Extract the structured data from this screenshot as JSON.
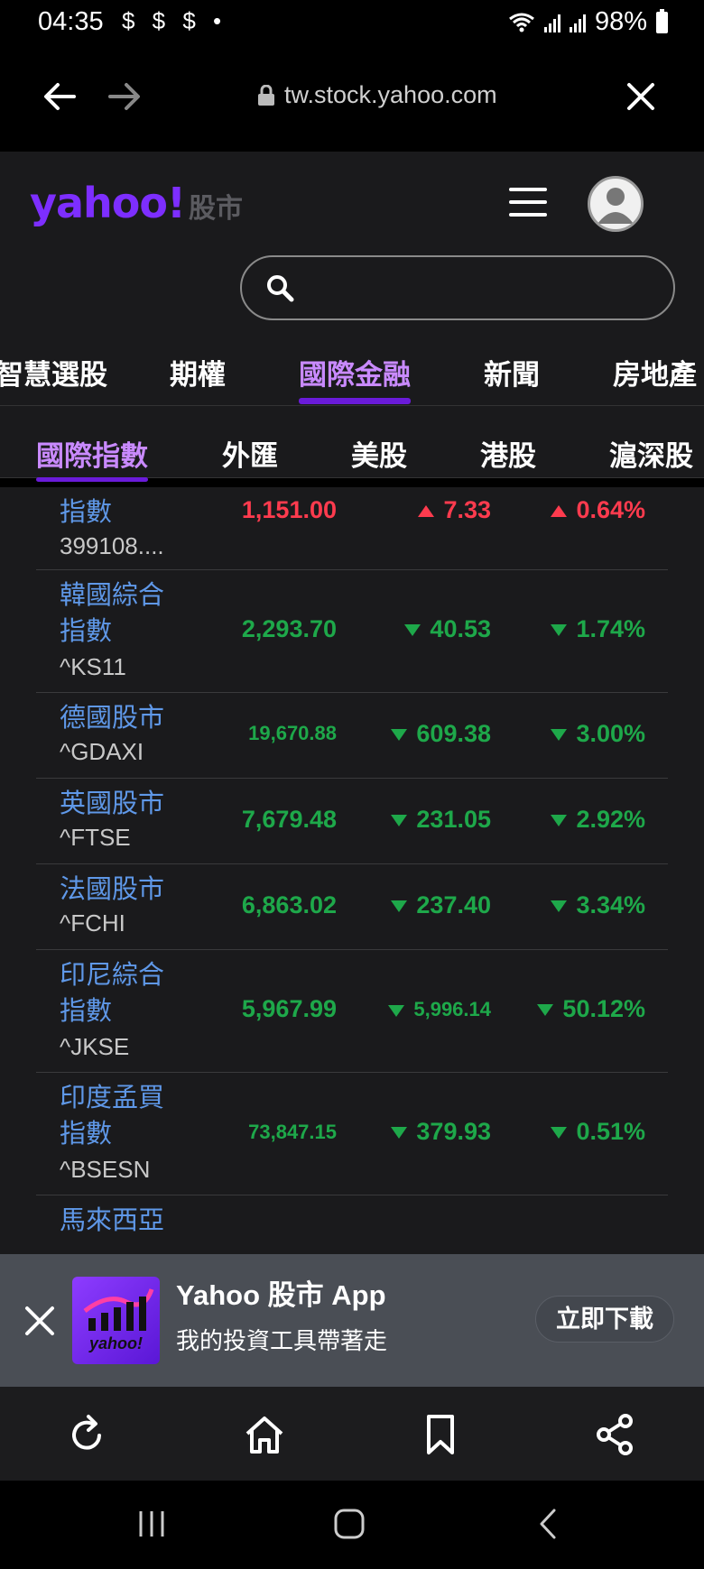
{
  "status": {
    "time": "04:35",
    "indicators": "$ $ $ •",
    "battery": "98%"
  },
  "browser": {
    "url": "tw.stock.yahoo.com"
  },
  "header": {
    "logo": "yahoo!",
    "logo_sub": "股市"
  },
  "search": {
    "placeholder": ""
  },
  "main_tabs": [
    {
      "label": "智慧選股"
    },
    {
      "label": "期權"
    },
    {
      "label": "國際金融"
    },
    {
      "label": "新聞"
    },
    {
      "label": "房地產"
    }
  ],
  "sub_tabs": [
    {
      "label": "國際指數"
    },
    {
      "label": "外匯"
    },
    {
      "label": "美股"
    },
    {
      "label": "港股"
    },
    {
      "label": "滬深股"
    }
  ],
  "rows": [
    {
      "name1": "指數",
      "name2": "",
      "symbol": "399108....",
      "price": "1,151.00",
      "change": "7.33",
      "pct": "0.64%",
      "dir": "up"
    },
    {
      "name1": "韓國綜合",
      "name2": "指數",
      "symbol": "^KS11",
      "price": "2,293.70",
      "change": "40.53",
      "pct": "1.74%",
      "dir": "down"
    },
    {
      "name1": "德國股市",
      "name2": "",
      "symbol": "^GDAXI",
      "price": "19,670.88",
      "change": "609.38",
      "pct": "3.00%",
      "dir": "down"
    },
    {
      "name1": "英國股市",
      "name2": "",
      "symbol": "^FTSE",
      "price": "7,679.48",
      "change": "231.05",
      "pct": "2.92%",
      "dir": "down"
    },
    {
      "name1": "法國股市",
      "name2": "",
      "symbol": "^FCHI",
      "price": "6,863.02",
      "change": "237.40",
      "pct": "3.34%",
      "dir": "down"
    },
    {
      "name1": "印尼綜合",
      "name2": "指數",
      "symbol": "^JKSE",
      "price": "5,967.99",
      "change": "5,996.14",
      "pct": "50.12%",
      "dir": "down"
    },
    {
      "name1": "印度孟買",
      "name2": "指數",
      "symbol": "^BSESN",
      "price": "73,847.15",
      "change": "379.93",
      "pct": "0.51%",
      "dir": "down"
    },
    {
      "name1": "馬來西亞",
      "name2": "",
      "symbol": "",
      "price": "",
      "change": "",
      "pct": "",
      "dir": "down"
    }
  ],
  "app_banner": {
    "title": "Yahoo 股市 App",
    "subtitle": "我的投資工具帶著走",
    "icon_text": "yahoo!",
    "button": "立即下載"
  },
  "colors": {
    "up": "#ff3b4e",
    "down": "#1ea84a",
    "accent": "#7d2eff",
    "active_tab": "#c98aff"
  }
}
